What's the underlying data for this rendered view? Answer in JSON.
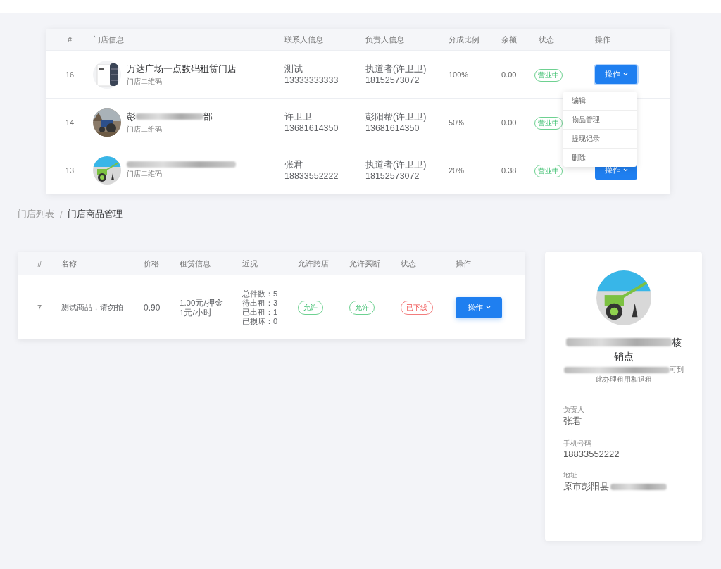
{
  "stores": {
    "columns": [
      "#",
      "门店信息",
      "联系人信息",
      "负责人信息",
      "分成比例",
      "余额",
      "状态",
      "操作"
    ],
    "rows": [
      {
        "id": "16",
        "name": "万达广场一点数码租赁门店",
        "name_start": "",
        "name_end": "",
        "qr": "门店二维码",
        "contact": "测试",
        "contact_phone": "13333333333",
        "owner": "执道者(许卫卫)",
        "owner_phone": "18152573072",
        "ratio": "100%",
        "balance": "0.00",
        "status": "营业中",
        "action": "操作",
        "focused": true
      },
      {
        "id": "14",
        "name_start": "彭",
        "name_end": "部",
        "qr": "门店二维码",
        "contact": "许卫卫",
        "contact_phone": "13681614350",
        "owner": "彭阳帮(许卫卫)",
        "owner_phone": "13681614350",
        "ratio": "50%",
        "balance": "0.00",
        "status": "营业中",
        "focused": false
      },
      {
        "id": "13",
        "name_start": "",
        "name_end": "",
        "qr": "门店二维码",
        "contact": "张君",
        "contact_phone": "18833552222",
        "owner": "执道者(许卫卫)",
        "owner_phone": "18152573072",
        "ratio": "20%",
        "balance": "0.38",
        "status": "营业中",
        "action": "操作",
        "focused": false
      }
    ],
    "menu": [
      "编辑",
      "物品管理",
      "提现记录",
      "删除"
    ]
  },
  "breadcrumb": [
    {
      "label": "门店列表",
      "selected": false
    },
    {
      "label": "门店商品管理",
      "selected": true
    }
  ],
  "breadcrumb_separator": "/",
  "goods": {
    "columns": [
      "#",
      "名称",
      "价格",
      "租赁信息",
      "近况",
      "允许跨店",
      "允许买断",
      "状态",
      "操作"
    ],
    "rows": [
      {
        "id": "7",
        "name": "测试商品，请勿拍",
        "price": "0.90",
        "rental": [
          "1.00元/押金",
          "1元/小时"
        ],
        "recent": [
          "总件数：5",
          "待出租：3",
          "已出租：1",
          "已损坏：0"
        ],
        "cross_store": {
          "label": "允许",
          "kind": "ok"
        },
        "buyout": {
          "label": "允许",
          "kind": "ok"
        },
        "status": {
          "label": "已下线",
          "kind": "off"
        },
        "action": "操作"
      }
    ]
  },
  "store_card": {
    "title_end": "核",
    "title_line2": "销点",
    "desc_end": "可到",
    "desc_line2": "此办理租用和退租",
    "fields": [
      {
        "label": "负责人",
        "value": "张君"
      },
      {
        "label": "手机号码",
        "value": "18833552222"
      },
      {
        "label": "地址",
        "value": "原市彭阳县"
      }
    ]
  }
}
